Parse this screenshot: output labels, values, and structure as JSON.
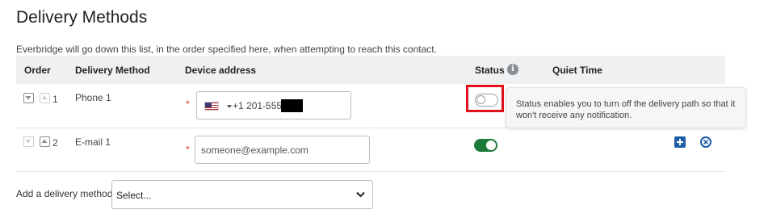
{
  "page": {
    "title": "Delivery Methods",
    "intro": "Everbridge will go down this list, in the order specified here, when attempting to reach this contact."
  },
  "table": {
    "headers": {
      "order": "Order",
      "method": "Delivery Method",
      "device": "Device address",
      "status": "Status",
      "quiet": "Quiet Time"
    },
    "rows": [
      {
        "order": "1",
        "method": "Phone 1",
        "required_mark": "*",
        "country": "US",
        "phone_value": "+1 201-555-",
        "status_on": false
      },
      {
        "order": "2",
        "method": "E-mail 1",
        "required_mark": "*",
        "email_placeholder": "someone@example.com",
        "status_on": true
      }
    ]
  },
  "tooltip": {
    "text": "Status enables you to turn off the delivery path so that it won't receive any notification."
  },
  "add_method": {
    "label": "Add a delivery method:",
    "selected": "Select..."
  },
  "colors": {
    "highlight": "#e0101c",
    "toggle_on": "#1e7a3b",
    "action_blue": "#1d5ea8",
    "required": "#d9342b"
  },
  "icons": [
    "move-down-icon",
    "move-up-icon",
    "info-icon",
    "us-flag-icon",
    "add-icon",
    "remove-icon",
    "chevron-down-icon"
  ]
}
